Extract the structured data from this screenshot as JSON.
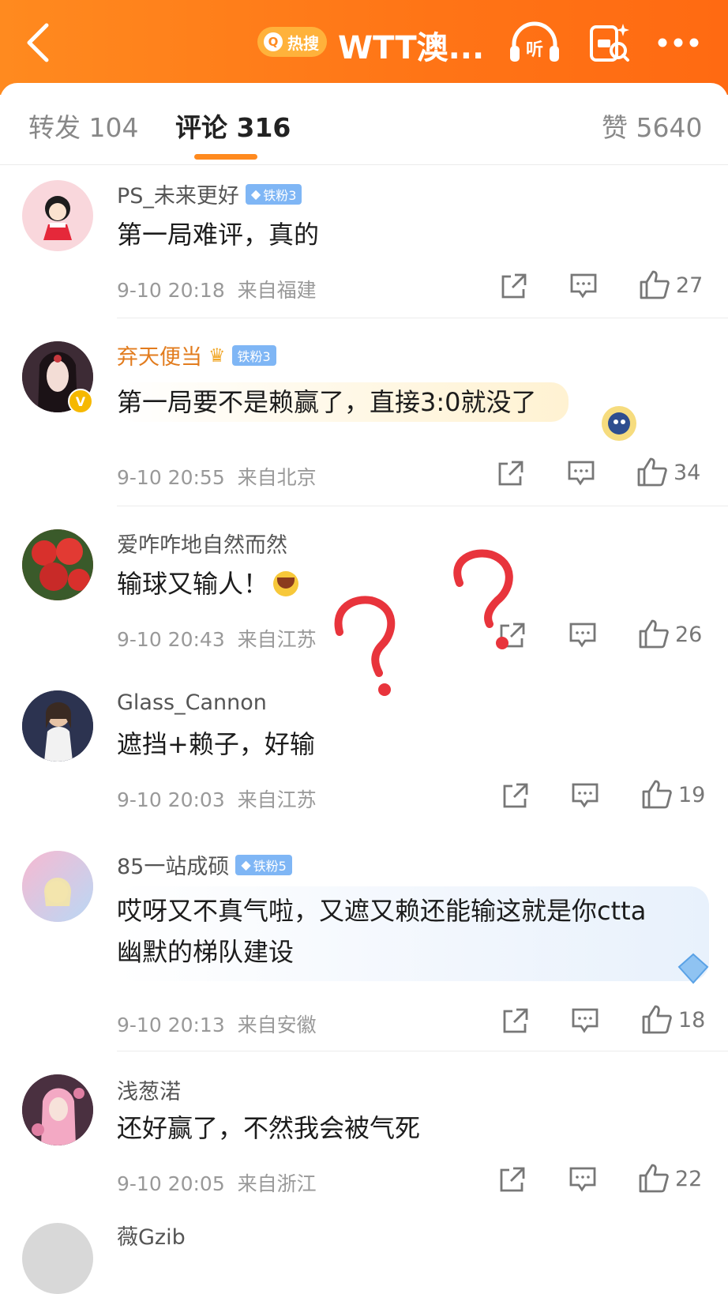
{
  "header": {
    "hot_label": "热搜",
    "title": "WTT澳...",
    "listen_label": "听"
  },
  "tabs": {
    "repost": "转发 104",
    "comments": "评论 316",
    "likes": "赞 5640"
  },
  "comments": [
    {
      "user": "PS_未来更好",
      "fan_badge": "铁粉3",
      "text": "第一局难评，真的",
      "time": "9-10 20:18",
      "location": "来自福建",
      "likes": "27"
    },
    {
      "user": "弃天便当",
      "fan_badge": "铁粉3",
      "text": "第一局要不是赖赢了，直接3:0就没了",
      "time": "9-10 20:55",
      "location": "来自北京",
      "likes": "34"
    },
    {
      "user": "爱咋咋地自然而然",
      "text": "输球又输人！",
      "time": "9-10 20:43",
      "location": "来自江苏",
      "likes": "26"
    },
    {
      "user": "Glass_Cannon",
      "text": "遮挡+赖子，好输",
      "time": "9-10 20:03",
      "location": "来自江苏",
      "likes": "19"
    },
    {
      "user": "85一站成硕",
      "fan_badge": "铁粉5",
      "text_line1": "哎呀又不真气啦，又遮又赖还能输这就是你ctta",
      "text_line2": "幽默的梯队建设",
      "time": "9-10 20:13",
      "location": "来自安徽",
      "likes": "18"
    },
    {
      "user": "浅葱渃",
      "text": "还好赢了，不然我会被气死",
      "time": "9-10 20:05",
      "location": "来自浙江",
      "likes": "22"
    }
  ],
  "partial_user": "薇Gzib",
  "colors": {
    "header_orange": "#ff7a18",
    "tab_underline": "#ff8a1f",
    "question_mark_red": "#e8343c",
    "fan_badge_blue": "#7fb6f5"
  }
}
